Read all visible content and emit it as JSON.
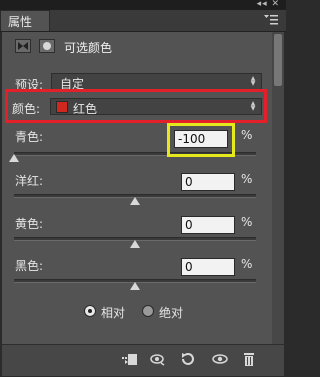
{
  "window": {
    "title_close": "◂◂ ✕"
  },
  "panel_tab": {
    "label": "属性"
  },
  "header": {
    "title": "可选颜色"
  },
  "preset": {
    "label": "预设:",
    "value": "自定"
  },
  "colors": {
    "label": "颜色:",
    "value": "红色",
    "swatch": "#d0271e"
  },
  "sliders": [
    {
      "name": "青色:",
      "value": "-100",
      "unit": "%"
    },
    {
      "name": "洋红:",
      "value": "0",
      "unit": "%"
    },
    {
      "name": "黄色:",
      "value": "0",
      "unit": "%"
    },
    {
      "name": "黑色:",
      "value": "0",
      "unit": "%"
    }
  ],
  "method": {
    "relative": "相对",
    "absolute": "绝对",
    "selected": "relative"
  },
  "accent": {
    "highlight_red": "#e3202a",
    "highlight_yellow": "#e5e81d"
  }
}
